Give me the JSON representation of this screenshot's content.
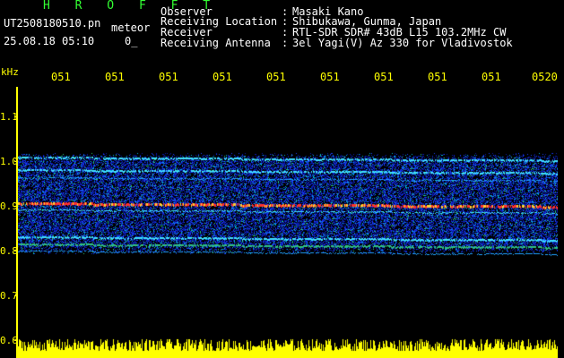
{
  "header": {
    "app_title": "H R O F F T",
    "filename": "UT2508180510.pn",
    "meteor_label": "meteor",
    "timestamp": "25.08.18 05:10",
    "zero_value": "0_",
    "rows": [
      {
        "label": "Observer",
        "value": "Masaki Kano"
      },
      {
        "label": "Receiving Location",
        "value": "Shibukawa, Gunma, Japan"
      },
      {
        "label": "Receiver",
        "value": "RTL-SDR SDR# 43dB L15 103.2MHz CW"
      },
      {
        "label": "Receiving Antenna",
        "value": "3el Yagi(V) Az 330 for Vladivostok"
      }
    ],
    "separator": ":"
  },
  "axes": {
    "y_unit": "kHz",
    "y_ticks": [
      "1.1",
      "1.0",
      "0.9",
      "0.8",
      "0.7",
      "0.6"
    ],
    "x_ticks": [
      "051",
      "051",
      "051",
      "051",
      "051",
      "051",
      "051",
      "051",
      "051",
      "0520"
    ]
  },
  "colors": {
    "axis": "#ffff00",
    "title": "#33ff33",
    "background": "#000000",
    "noise": "#1a2fff",
    "signal": "#ff3030"
  }
}
